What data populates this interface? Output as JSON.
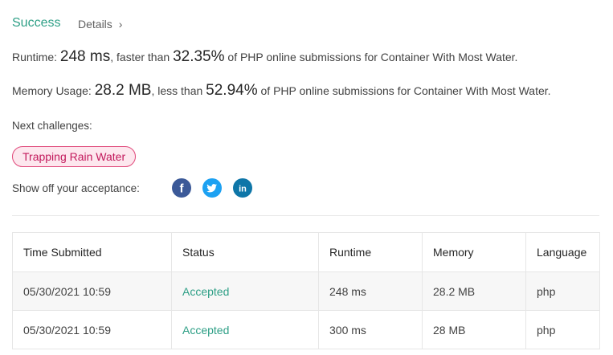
{
  "header": {
    "status": "Success",
    "details_label": "Details"
  },
  "runtime": {
    "label": "Runtime: ",
    "value": "248 ms",
    "comparison": ", faster than ",
    "percent": "32.35%",
    "suffix": " of PHP online submissions for Container With Most Water."
  },
  "memory": {
    "label": "Memory Usage: ",
    "value": "28.2 MB",
    "comparison": ", less than ",
    "percent": "52.94%",
    "suffix": " of PHP online submissions for Container With Most Water."
  },
  "next_challenges": {
    "label": "Next challenges:",
    "items": [
      "Trapping Rain Water"
    ]
  },
  "share": {
    "label": "Show off your acceptance:",
    "icons": [
      "facebook-icon",
      "twitter-icon",
      "linkedin-icon"
    ]
  },
  "colors": {
    "accent": "#2e9f86",
    "tag_border": "#e0487a",
    "tag_bg": "#fde7ee",
    "facebook": "#3b5998",
    "twitter": "#1da1f2",
    "linkedin": "#0e76a8"
  },
  "table": {
    "headers": [
      "Time Submitted",
      "Status",
      "Runtime",
      "Memory",
      "Language"
    ],
    "rows": [
      {
        "time": "05/30/2021 10:59",
        "status": "Accepted",
        "runtime": "248 ms",
        "memory": "28.2 MB",
        "language": "php"
      },
      {
        "time": "05/30/2021 10:59",
        "status": "Accepted",
        "runtime": "300 ms",
        "memory": "28 MB",
        "language": "php"
      }
    ]
  }
}
